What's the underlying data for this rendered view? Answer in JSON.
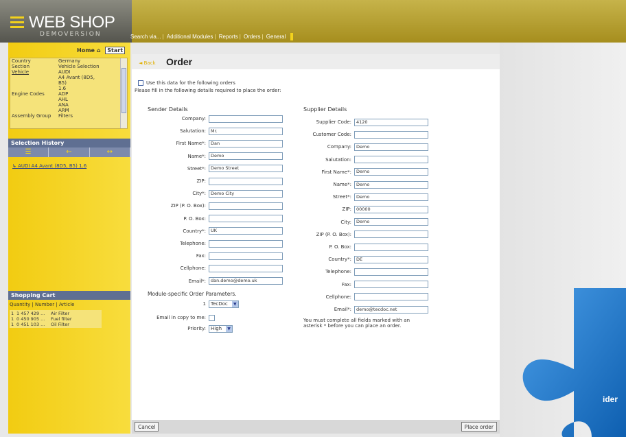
{
  "logo": {
    "title": "WEB SHOP",
    "subtitle": "DEMOVERSION"
  },
  "topnav": [
    "Search via...",
    "Additional Modules",
    "Reports",
    "Orders",
    "General"
  ],
  "sidebar": {
    "home": "Home",
    "start": "Start",
    "selection": [
      {
        "key": "Country",
        "value": "Germany"
      },
      {
        "key": "Section",
        "value": "Vehicle Selection"
      },
      {
        "key": "Vehicle",
        "value": "AUDI"
      },
      {
        "key": "",
        "value": "A4 Avant (8D5,"
      },
      {
        "key": "",
        "value": "B5)"
      },
      {
        "key": "",
        "value": "1.6"
      },
      {
        "key": "Engine Codes",
        "value": "ADP"
      },
      {
        "key": "",
        "value": "AHL"
      },
      {
        "key": "",
        "value": "ANA"
      },
      {
        "key": "",
        "value": "ARM"
      },
      {
        "key": "Assembly Group",
        "value": "Filters"
      }
    ],
    "history_title": "Selection History",
    "history_link": "AUDI A4 Avant (8D5, B5) 1.6",
    "cart_title": "Shopping Cart",
    "cart_columns": "Quantity | Number | Article",
    "cart_items": [
      {
        "qty": "1",
        "number": "1 457 429 ...",
        "article": "Air Filter"
      },
      {
        "qty": "1",
        "number": "0 450 905 ...",
        "article": "Fuel filter"
      },
      {
        "qty": "1",
        "number": "0 451 103 ...",
        "article": "Oil Filter"
      }
    ]
  },
  "main": {
    "back": "Back",
    "title": "Order",
    "use_data": "Use this data for the following orders",
    "fill_details": "Please fill in the following details required to place the order:",
    "sender_title": "Sender Details",
    "sender_fields": [
      {
        "label": "Company:",
        "value": ""
      },
      {
        "label": "Salutation:",
        "value": "Mr."
      },
      {
        "label": "First Name*:",
        "value": "Dan"
      },
      {
        "label": "Name*:",
        "value": "Demo"
      },
      {
        "label": "Street*:",
        "value": "Demo Street"
      },
      {
        "label": "ZIP:",
        "value": ""
      },
      {
        "label": "City*:",
        "value": "Demo City"
      },
      {
        "label": "ZIP (P. O. Box):",
        "value": ""
      },
      {
        "label": "P. O. Box:",
        "value": ""
      },
      {
        "label": "Country*:",
        "value": "UK"
      },
      {
        "label": "Telephone:",
        "value": ""
      },
      {
        "label": "Fax:",
        "value": ""
      },
      {
        "label": "Cellphone:",
        "value": ""
      },
      {
        "label": "Email*:",
        "value": "dan.demo@demo.uk"
      }
    ],
    "supplier_title": "Supplier Details",
    "supplier_fields": [
      {
        "label": "Supplier Code:",
        "value": "4120"
      },
      {
        "label": "Customer Code:",
        "value": ""
      },
      {
        "label": "Company:",
        "value": "Demo"
      },
      {
        "label": "Salutation:",
        "value": ""
      },
      {
        "label": "First Name*:",
        "value": "Demo"
      },
      {
        "label": "Name*:",
        "value": "Demo"
      },
      {
        "label": "Street*:",
        "value": "Demo"
      },
      {
        "label": "ZIP:",
        "value": "00000"
      },
      {
        "label": "City:",
        "value": "Demo"
      },
      {
        "label": "ZIP (P. O. Box):",
        "value": ""
      },
      {
        "label": "P. O. Box:",
        "value": ""
      },
      {
        "label": "Country*:",
        "value": "DE"
      },
      {
        "label": "Telephone:",
        "value": ""
      },
      {
        "label": "Fax:",
        "value": ""
      },
      {
        "label": "Cellphone:",
        "value": ""
      },
      {
        "label": "Email*:",
        "value": "demo@tecdoc.net"
      }
    ],
    "module_title": "Module-specific Order Parameters.",
    "module_label": "1",
    "module_value": "TecDoc",
    "email_copy_label": "Email in copy to me:",
    "priority_label": "Priority:",
    "priority_value": "High",
    "must_complete": "You must complete all fields marked with an asterisk * before you can place an order.",
    "cancel": "Cancel",
    "place_order": "Place order"
  },
  "puzzle_text": "ider",
  "colors": {
    "accent": "#f3d21c",
    "panel": "#5f6f92",
    "puzzle": "#1b73c6"
  }
}
